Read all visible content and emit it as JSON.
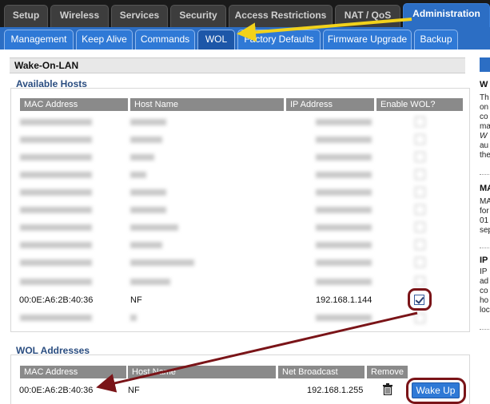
{
  "main_tabs": [
    {
      "label": "Setup"
    },
    {
      "label": "Wireless"
    },
    {
      "label": "Services"
    },
    {
      "label": "Security"
    },
    {
      "label": "Access Restrictions"
    },
    {
      "label": "NAT / QoS"
    },
    {
      "label": "Administration",
      "active": true
    }
  ],
  "sub_tabs": [
    {
      "label": "Management"
    },
    {
      "label": "Keep Alive"
    },
    {
      "label": "Commands"
    },
    {
      "label": "WOL",
      "active": true
    },
    {
      "label": "Factory Defaults"
    },
    {
      "label": "Firmware Upgrade"
    },
    {
      "label": "Backup"
    }
  ],
  "page_title": "Wake-On-LAN",
  "available_hosts": {
    "title": "Available Hosts",
    "columns": [
      "MAC Address",
      "Host Name",
      "IP Address",
      "Enable WOL?"
    ],
    "rows": [
      {
        "mac": "00:0E:A6:2B:40:36",
        "host": "NF",
        "ip": "192.168.1.144",
        "enabled": true
      }
    ]
  },
  "wol_addresses": {
    "title": "WOL Addresses",
    "columns": [
      "MAC Address",
      "Host Name",
      "Net Broadcast",
      "Remove"
    ],
    "rows": [
      {
        "mac": "00:0E:A6:2B:40:36",
        "host": "NF",
        "broadcast": "192.168.1.255"
      }
    ],
    "wake_button": "Wake Up"
  },
  "colors": {
    "accent_blue": "#2c6ec4",
    "annotation_red": "#7a1418",
    "annotation_yellow": "#f2d21b"
  },
  "icons": [
    "trash-icon",
    "checkbox-icon",
    "arrow-annotation-icon"
  ]
}
